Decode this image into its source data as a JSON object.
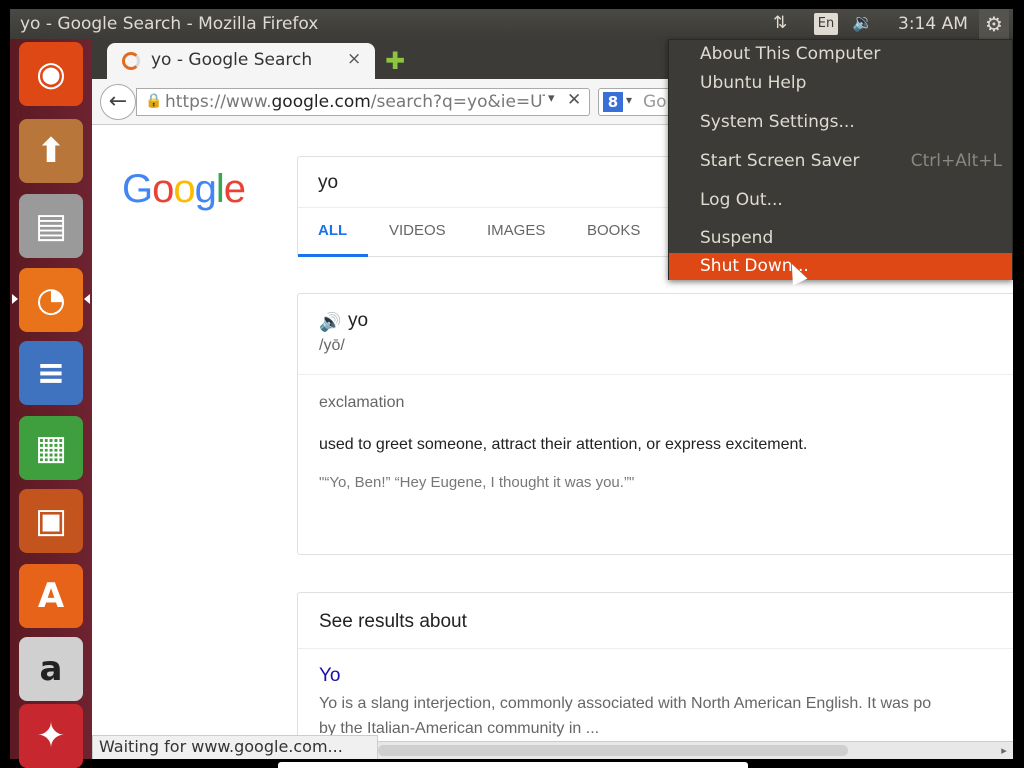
{
  "window": {
    "title": "yo - Google Search - Mozilla Firefox"
  },
  "panel": {
    "network_icon": "⇅",
    "keyboard_layout": "En",
    "volume_icon": "🔉",
    "clock": "3:14 AM",
    "session_icon": "⚙"
  },
  "launcher": {
    "items": [
      {
        "name": "Dash",
        "glyph": "◉",
        "color": "#dd4814"
      },
      {
        "name": "Ubuntu Software Center",
        "glyph": "⬆",
        "color": "#b8763a"
      },
      {
        "name": "Files",
        "glyph": "▤",
        "color": "#9a9a9a"
      },
      {
        "name": "Firefox Web Browser",
        "glyph": "◔",
        "color": "#e8731a"
      },
      {
        "name": "LibreOffice Writer",
        "glyph": "≡",
        "color": "#3f73bf"
      },
      {
        "name": "LibreOffice Calc",
        "glyph": "▦",
        "color": "#3f9f3f"
      },
      {
        "name": "LibreOffice Impress",
        "glyph": "▣",
        "color": "#c4541e"
      },
      {
        "name": "Ubuntu Software",
        "glyph": "A",
        "color": "#e8631a"
      },
      {
        "name": "Amazon",
        "glyph": "a",
        "color": "#d0d0d0"
      },
      {
        "name": "System",
        "glyph": "✦",
        "color": "#c7282f"
      }
    ]
  },
  "browser": {
    "tab": {
      "title": "yo - Google Search",
      "close": "×"
    },
    "new_tab": "✚",
    "back": "←",
    "url": {
      "prefix": "https://www.",
      "domain": "google.com",
      "suffix": "/search?q=yo&ie=UT",
      "drop": "▾",
      "clear": "✕"
    },
    "search": {
      "engine": "8",
      "drop": "▾",
      "placeholder": "Go"
    },
    "status": "Waiting for www.google.com...",
    "scroll_arrow": "▸"
  },
  "google": {
    "logo": [
      "G",
      "o",
      "o",
      "g",
      "l",
      "e"
    ],
    "logo_colors": [
      "#4285f4",
      "#ea4335",
      "#fbbc05",
      "#4285f4",
      "#34a853",
      "#ea4335"
    ],
    "query": "yo",
    "tabs": [
      "ALL",
      "VIDEOS",
      "IMAGES",
      "BOOKS"
    ],
    "dictionary": {
      "word": "yo",
      "phonetic": "/yō/",
      "part_of_speech": "exclamation",
      "definition": "used to greet someone, attract their attention, or express excitement.",
      "example": "\"“Yo, Ben!” “Hey Eugene, I thought it was you.”\""
    },
    "about": {
      "title": "See results about",
      "link": "Yo",
      "desc1": "Yo is a slang interjection, commonly associated with North American English. It was po",
      "desc2": "by the Italian-American community in ..."
    }
  },
  "menu": {
    "items": [
      {
        "label": "About This Computer",
        "accel": ""
      },
      {
        "label": "Ubuntu Help",
        "accel": ""
      },
      {
        "label": "System Settings...",
        "accel": ""
      },
      {
        "label": "Start Screen Saver",
        "accel": "Ctrl+Alt+L"
      },
      {
        "label": "Log Out...",
        "accel": ""
      },
      {
        "label": "Suspend",
        "accel": ""
      },
      {
        "label": "Shut Down...",
        "accel": ""
      }
    ],
    "highlight_color": "#dd4814"
  }
}
